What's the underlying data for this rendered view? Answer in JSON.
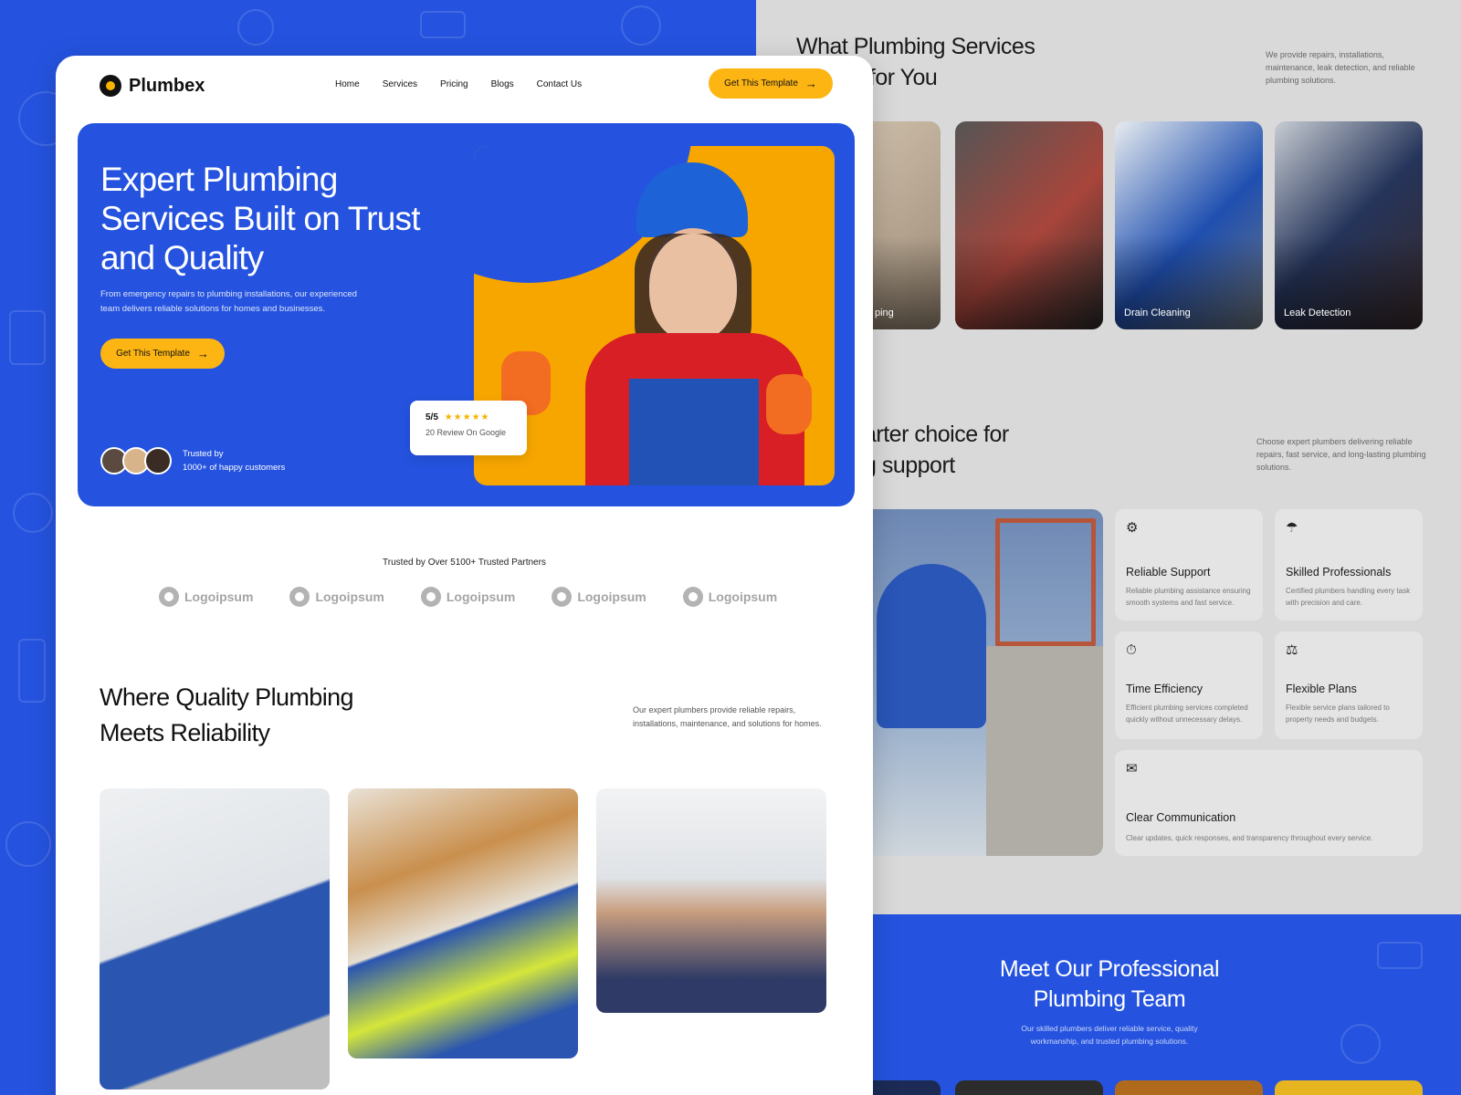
{
  "brand": {
    "name": "Plumbex"
  },
  "nav": {
    "items": [
      "Home",
      "Services",
      "Pricing",
      "Blogs",
      "Contact Us"
    ]
  },
  "cta": {
    "header_label": "Get This Template",
    "hero_label": "Get This Template"
  },
  "hero": {
    "title": "Expert Plumbing Services Built on Trust and Quality",
    "subtitle": "From emergency repairs to plumbing installations, our experienced team delivers reliable solutions for homes and businesses.",
    "review_score": "5/5",
    "review_stars": "★★★★★",
    "review_text": "20 Review On Google",
    "trusted_line1": "Trusted by",
    "trusted_line2": "1000+ of happy customers"
  },
  "partners": {
    "title": "Trusted by Over 5100+ Trusted  Partners",
    "items": [
      "Logoipsum",
      "Logoipsum",
      "Logoipsum",
      "Logoipsum",
      "Logoipsum"
    ]
  },
  "quality": {
    "title": "Where Quality Plumbing Meets Reliability",
    "description": "Our expert plumbers provide reliable repairs, installations, maintenance, and solutions for homes."
  },
  "services": {
    "title": "What Plumbing Services We Do for You",
    "description": "We provide repairs, installations, maintenance, leak detection, and reliable plumbing solutions.",
    "cards": [
      "ping",
      "",
      "Drain Cleaning",
      "Leak Detection"
    ]
  },
  "choice": {
    "title": "arter choice for g support",
    "description": "Choose expert plumbers delivering reliable repairs, fast service, and long-lasting plumbing solutions.",
    "features": [
      {
        "title": "Reliable Support",
        "desc": "Reliable plumbing assistance ensuring smooth systems and fast service."
      },
      {
        "title": "Skilled Professionals",
        "desc": "Certified plumbers handling every task with precision and care."
      },
      {
        "title": "Time Efficiency",
        "desc": "Efficient plumbing services completed quickly without unnecessary delays."
      },
      {
        "title": "Flexible Plans",
        "desc": "Flexible service plans tailored to property needs and budgets."
      },
      {
        "title": "Clear Communication",
        "desc": "Clear updates, quick responses, and transparency throughout every service."
      }
    ]
  },
  "team": {
    "title": "Meet Our Professional Plumbing Team",
    "description": "Our skilled plumbers deliver reliable service, quality workmanship, and trusted plumbing solutions."
  },
  "colors": {
    "brand_blue": "#2553df",
    "accent_yellow": "#fcb513"
  }
}
